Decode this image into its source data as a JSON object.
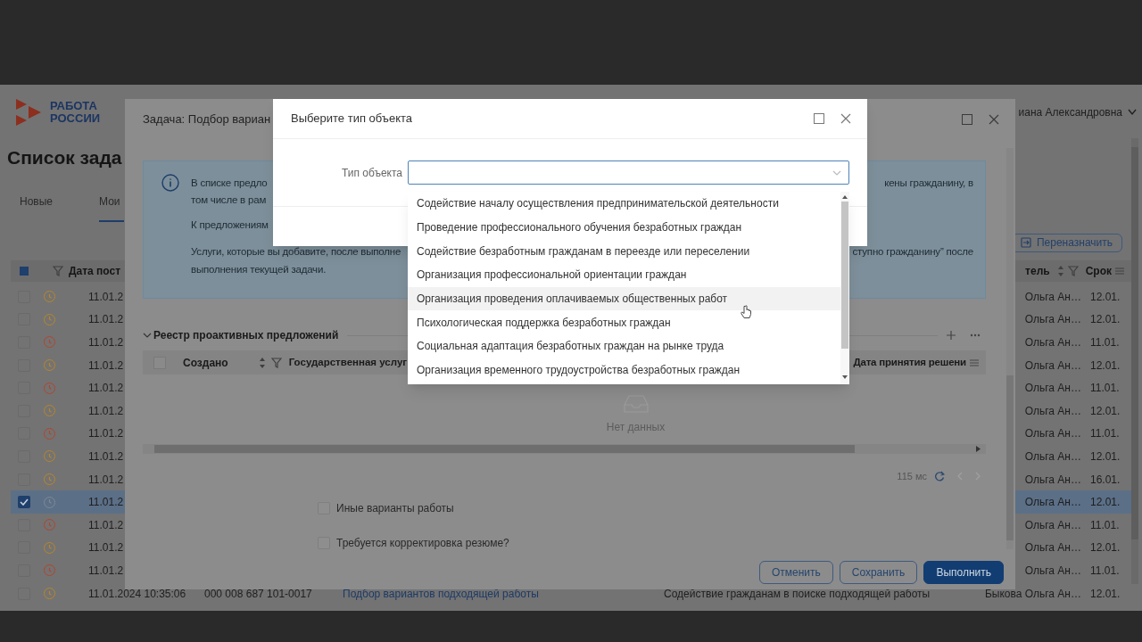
{
  "app": {
    "logo": {
      "line1": "РАБОТА",
      "line2": "РОССИИ"
    },
    "user": "иана Александровна",
    "page_title": "Список зада",
    "tabs": [
      {
        "label": "Новые",
        "selected": false
      },
      {
        "label": "Мои",
        "selected": true
      }
    ],
    "reassign_button": "Переназначить",
    "select_all_indeterminate": true,
    "columns": [
      {
        "label": "Дата пост"
      },
      {
        "label": "тель"
      },
      {
        "label": "Срок"
      }
    ],
    "rows": [
      {
        "overdue": false,
        "date": "11.01.2",
        "executor": "Ольга Ан…",
        "deadline": "12.01.",
        "selected": false
      },
      {
        "overdue": false,
        "date": "11.01.2",
        "executor": "Ольга Ан…",
        "deadline": "12.01.",
        "selected": false
      },
      {
        "overdue": true,
        "date": "11.01.2",
        "executor": "Ольга Ан…",
        "deadline": "11.01.",
        "selected": false
      },
      {
        "overdue": false,
        "date": "11.01.2",
        "executor": "Ольга Ан…",
        "deadline": "12.01.",
        "selected": false
      },
      {
        "overdue": true,
        "date": "11.01.2",
        "executor": "Ольга Ан…",
        "deadline": "11.01.",
        "selected": false
      },
      {
        "overdue": false,
        "date": "11.01.2",
        "executor": "Ольга Ан…",
        "deadline": "12.01.",
        "selected": false
      },
      {
        "overdue": true,
        "date": "11.01.2",
        "executor": "Ольга Ан…",
        "deadline": "11.01.",
        "selected": false
      },
      {
        "overdue": false,
        "date": "11.01.2",
        "executor": "Ольга Ан…",
        "deadline": "12.01.",
        "selected": false
      },
      {
        "overdue": false,
        "date": "11.01.2",
        "executor": "Ольга Ан…",
        "deadline": "16.01.",
        "selected": false
      },
      {
        "overdue": false,
        "date": "11.01.2",
        "executor": "Ольга Ан…",
        "deadline": "12.01.",
        "selected": true
      },
      {
        "overdue": true,
        "date": "11.01.2",
        "executor": "Ольга Ан…",
        "deadline": "11.01.",
        "selected": false
      },
      {
        "overdue": false,
        "date": "11.01.2",
        "executor": "Ольга Ан…",
        "deadline": "12.01.",
        "selected": false
      },
      {
        "overdue": true,
        "date": "11.01.2",
        "executor": "Ольга Ан…",
        "deadline": "11.01.",
        "selected": false
      },
      {
        "overdue": false,
        "date": "11.01.2024 10:35:06",
        "number": "000 008 687 101-0017",
        "task": "Подбор вариантов подходящей работы",
        "service": "Содействие гражданам в поиске подходящей работы",
        "executor": "Быкова Ольга Ан…",
        "deadline": "12.01.",
        "selected": false
      }
    ]
  },
  "task_dialog": {
    "title": "Задача: Подбор вариан",
    "info_lines": [
      {
        "left": "В списке предло",
        "right": "кены гражданину, в"
      },
      {
        "left": "том числе в рам"
      },
      {
        "left": "К предложениям"
      },
      {
        "left": "Услуги, которые вы добавите, после выполне",
        "right": "ступно гражданину” после"
      },
      {
        "left": "выполнения текущей задачи."
      }
    ],
    "section": {
      "title": "Реестр проактивных предложений",
      "expanded": true
    },
    "header_checked": false,
    "columns": [
      {
        "label": "Создано"
      },
      {
        "label": "Государственная услуг"
      },
      {
        "label": "Дата принятия решени"
      }
    ],
    "empty_text": "Нет данных",
    "timing": "115 мс",
    "checkboxes": [
      {
        "label": "Иные варианты работы",
        "checked": false
      },
      {
        "label": "Требуется корректировка резюме?",
        "checked": false
      }
    ],
    "buttons": [
      {
        "label": "Отменить",
        "kind": "outline"
      },
      {
        "label": "Сохранить",
        "kind": "outline"
      },
      {
        "label": "Выполнить",
        "kind": "primary"
      }
    ]
  },
  "object_dialog": {
    "title": "Выберите тип объекта",
    "field_label": "Тип объекта",
    "options": [
      {
        "label": "Содействие началу осуществления предпринимательской деятельности",
        "hovered": false
      },
      {
        "label": "Проведение профессионального обучения безработных граждан",
        "hovered": false
      },
      {
        "label": "Содействие безработным гражданам в переезде или переселении",
        "hovered": false
      },
      {
        "label": "Организация профессиональной ориентации граждан",
        "hovered": false
      },
      {
        "label": "Организация проведения оплачиваемых общественных работ",
        "hovered": true
      },
      {
        "label": "Психологическая поддержка безработных граждан",
        "hovered": false
      },
      {
        "label": "Социальная адаптация безработных граждан на рынке труда",
        "hovered": false
      },
      {
        "label": "Организация временного трудоустройства безработных граждан",
        "hovered": false
      }
    ]
  }
}
